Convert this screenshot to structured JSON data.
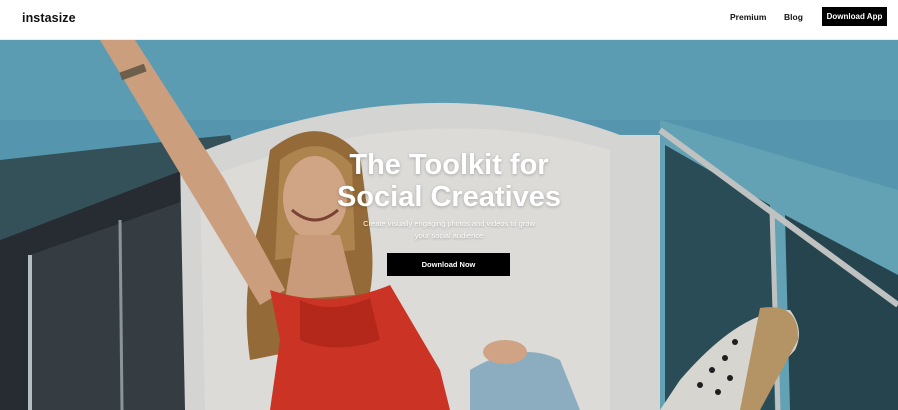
{
  "header": {
    "logo": "instasize",
    "nav": {
      "premium": "Premium",
      "blog": "Blog",
      "download_app": "Download App"
    }
  },
  "hero": {
    "headline_line1": "The Toolkit for",
    "headline_line2": "Social Creatives",
    "subtext_line1": "Create visually engaging photos and videos to grow",
    "subtext_line2": "your social audience",
    "cta": "Download Now"
  },
  "colors": {
    "sky_wall": "#5fa8c2",
    "shirt": "#e23a2a",
    "button_bg": "#000000",
    "text_on_dark": "#ffffff"
  }
}
